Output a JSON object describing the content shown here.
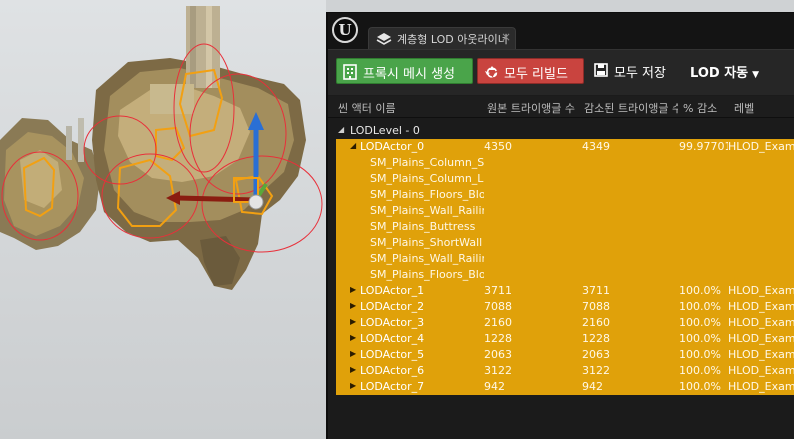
{
  "tab": {
    "logo": "unreal-engine-logo",
    "label": "계층형 LOD 아웃라이너",
    "close": "×"
  },
  "toolbar": {
    "proxy_label": "프록시 메시 생성",
    "rebuild_label": "모두 리빌드",
    "save_label": "모두 저장",
    "lod_label": "LOD 자동"
  },
  "columns": {
    "actor_name": "씬 액터 이름",
    "original_tris": "원본 트라이앵글 수",
    "reduced_tris": "감소된 트라이앵글 수",
    "percent": "% 감소",
    "level": "레벨"
  },
  "lod_level": "LODLevel - 0",
  "lod_actor_0": {
    "name": "LODActor_0",
    "original": "4350",
    "reduced": "4349",
    "percent": "99.97701",
    "level": "HLOD_Example"
  },
  "meshes": [
    "SM_Plains_Column_Straight",
    "SM_Plains_Column_Large",
    "SM_Plains_Floors_Block",
    "SM_Plains_Wall_Railing",
    "SM_Plains_Buttress",
    "SM_Plains_ShortWall",
    "SM_Plains_Wall_Railing",
    "SM_Plains_Floors_Block"
  ],
  "actors": [
    {
      "name": "LODActor_1",
      "original": "3711",
      "reduced": "3711",
      "percent": "100.0%",
      "level": "HLOD_Example"
    },
    {
      "name": "LODActor_2",
      "original": "7088",
      "reduced": "7088",
      "percent": "100.0%",
      "level": "HLOD_Example"
    },
    {
      "name": "LODActor_3",
      "original": "2160",
      "reduced": "2160",
      "percent": "100.0%",
      "level": "HLOD_Example"
    },
    {
      "name": "LODActor_4",
      "original": "1228",
      "reduced": "1228",
      "percent": "100.0%",
      "level": "HLOD_Example"
    },
    {
      "name": "LODActor_5",
      "original": "2063",
      "reduced": "2063",
      "percent": "100.0%",
      "level": "HLOD_Example"
    },
    {
      "name": "LODActor_6",
      "original": "3122",
      "reduced": "3122",
      "percent": "100.0%",
      "level": "HLOD_Example"
    },
    {
      "name": "LODActor_7",
      "original": "942",
      "reduced": "942",
      "percent": "100.0%",
      "level": "HLOD_Example"
    }
  ],
  "colors": {
    "highlight": "#e0a10a",
    "green_button": "#4aa44a",
    "red_button": "#c9443f",
    "panel_bg": "#1b1b1b"
  }
}
